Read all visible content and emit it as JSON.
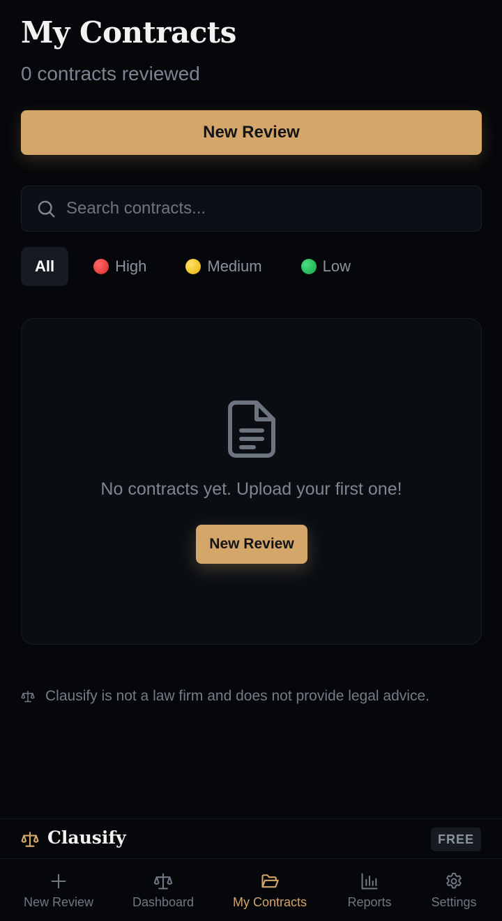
{
  "header": {
    "title": "My Contracts",
    "subtitle": "0 contracts reviewed"
  },
  "primary_action": {
    "label": "New Review"
  },
  "search": {
    "placeholder": "Search contracts...",
    "value": ""
  },
  "filters": [
    {
      "label": "All",
      "active": true
    },
    {
      "label": "High",
      "dot_color": "#ef4444"
    },
    {
      "label": "Medium",
      "dot_color": "#facc15"
    },
    {
      "label": "Low",
      "dot_color": "#22c55e"
    }
  ],
  "empty_state": {
    "icon": "document-icon",
    "message": "No contracts yet. Upload your first one!",
    "button_label": "New Review"
  },
  "disclaimer": "Clausify is not a law firm and does not provide legal advice.",
  "brand": {
    "name": "Clausify",
    "plan": "FREE"
  },
  "tabs": [
    {
      "label": "New Review",
      "icon": "plus-icon"
    },
    {
      "label": "Dashboard",
      "icon": "scale-icon"
    },
    {
      "label": "My Contracts",
      "icon": "folder-icon",
      "active": true
    },
    {
      "label": "Reports",
      "icon": "bar-chart-icon"
    },
    {
      "label": "Settings",
      "icon": "gear-icon"
    }
  ],
  "colors": {
    "accent": "#d4a66a",
    "background": "#05070a",
    "card": "#0a0e13"
  }
}
